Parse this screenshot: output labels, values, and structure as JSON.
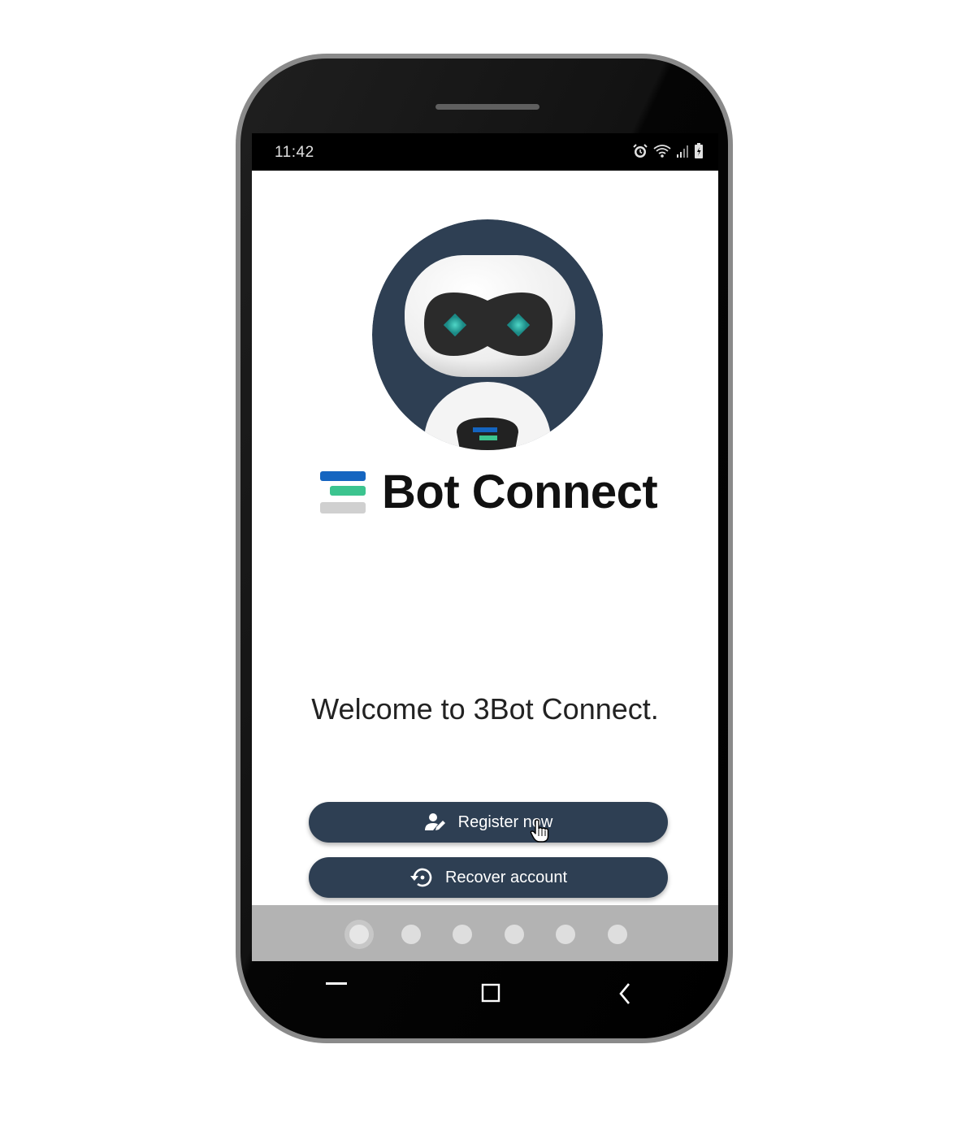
{
  "status_bar": {
    "time": "11:42",
    "icons": [
      "alarm-icon",
      "wifi-icon",
      "signal-icon",
      "battery-icon"
    ]
  },
  "app": {
    "name": "Bot Connect",
    "logo_colors": [
      "#1565c0",
      "#3cc48f",
      "#d0d0d0"
    ],
    "accent": "#2e3f53",
    "welcome_text": "Welcome to 3Bot Connect."
  },
  "actions": {
    "register_label": "Register now",
    "register_icon": "user-edit-icon",
    "recover_label": "Recover account",
    "recover_icon": "restore-icon"
  },
  "pager": {
    "count": 6,
    "active_index": 0
  },
  "navigation": {
    "buttons": [
      "recent-apps-icon",
      "home-icon",
      "back-icon"
    ]
  }
}
